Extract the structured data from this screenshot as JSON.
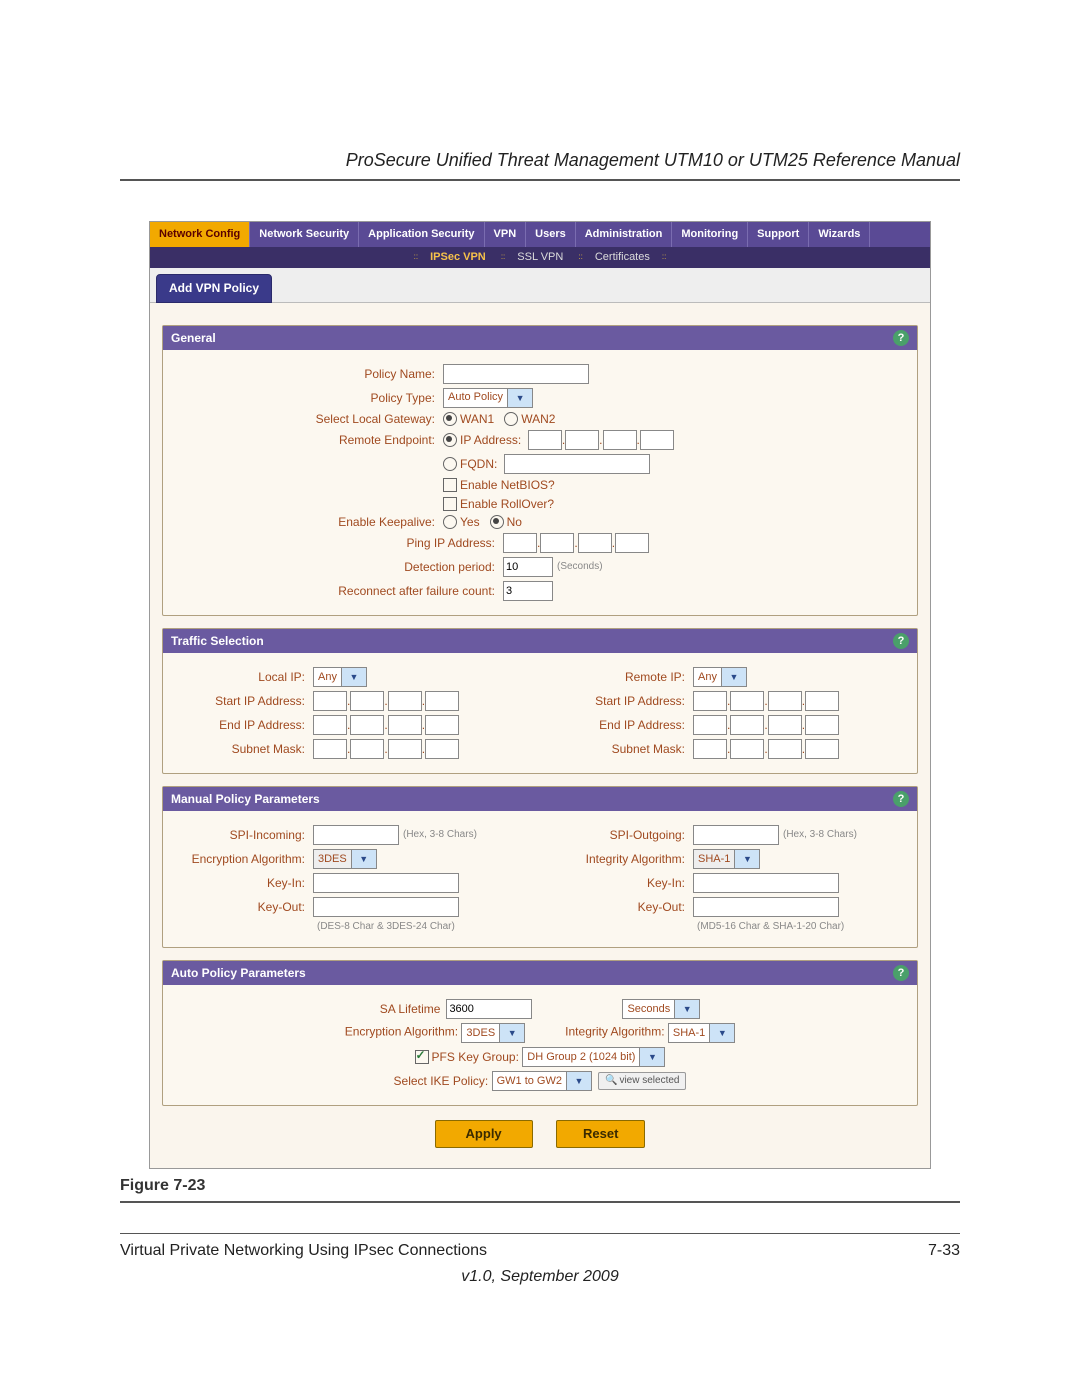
{
  "doc": {
    "header_title": "ProSecure Unified Threat Management UTM10 or UTM25 Reference Manual",
    "figure_caption": "Figure 7-23",
    "footer_left": "Virtual Private Networking Using IPsec Connections",
    "footer_right": "7-33",
    "version_line": "v1.0, September 2009"
  },
  "nav": {
    "items": [
      "Network Config",
      "Network Security",
      "Application Security",
      "VPN",
      "Users",
      "Administration",
      "Monitoring",
      "Support",
      "Wizards"
    ],
    "active": "Network Config"
  },
  "subnav": {
    "items": [
      "IPSec VPN",
      "SSL VPN",
      "Certificates"
    ],
    "active": "IPSec VPN"
  },
  "page_head": "Add VPN Policy",
  "sections": {
    "general": {
      "title": "General",
      "policy_name_label": "Policy Name:",
      "policy_name_value": "",
      "policy_type_label": "Policy Type:",
      "policy_type_value": "Auto Policy",
      "select_local_gw_label": "Select Local Gateway:",
      "wan1": "WAN1",
      "wan2": "WAN2",
      "remote_endpoint_label": "Remote Endpoint:",
      "ip_address_label": "IP Address:",
      "fqdn_label": "FQDN:",
      "enable_netbios": "Enable NetBIOS?",
      "enable_rollover": "Enable RollOver?",
      "enable_keepalive_label": "Enable Keepalive:",
      "yes": "Yes",
      "no": "No",
      "ping_ip_label": "Ping IP Address:",
      "detection_period_label": "Detection period:",
      "detection_period_value": "10",
      "detection_unit": "(Seconds)",
      "reconnect_label": "Reconnect after failure count:",
      "reconnect_value": "3"
    },
    "traffic": {
      "title": "Traffic Selection",
      "local_ip_label": "Local IP:",
      "local_ip_value": "Any",
      "remote_ip_label": "Remote IP:",
      "remote_ip_value": "Any",
      "start_ip_label": "Start IP Address:",
      "end_ip_label": "End IP Address:",
      "subnet_label": "Subnet Mask:"
    },
    "manual": {
      "title": "Manual Policy Parameters",
      "spi_in_label": "SPI-Incoming:",
      "spi_hint": "(Hex, 3-8 Chars)",
      "spi_out_label": "SPI-Outgoing:",
      "enc_alg_label": "Encryption Algorithm:",
      "enc_alg_value": "3DES",
      "int_alg_label": "Integrity Algorithm:",
      "int_alg_value": "SHA-1",
      "keyin_label": "Key-In:",
      "keyout_label": "Key-Out:",
      "enc_hint": "(DES-8 Char & 3DES-24 Char)",
      "int_hint": "(MD5-16 Char & SHA-1-20 Char)"
    },
    "auto": {
      "title": "Auto Policy Parameters",
      "sa_lifetime_label": "SA Lifetime",
      "sa_lifetime_value": "3600",
      "sa_unit": "Seconds",
      "enc_alg_label": "Encryption Algorithm:",
      "enc_alg_value": "3DES",
      "int_alg_label": "Integrity Algorithm:",
      "int_alg_value": "SHA-1",
      "pfs_label": "PFS Key Group:",
      "pfs_value": "DH Group 2 (1024 bit)",
      "ike_label": "Select IKE Policy:",
      "ike_value": "GW1 to GW2",
      "view_selected": "view selected"
    }
  },
  "buttons": {
    "apply": "Apply",
    "reset": "Reset"
  }
}
